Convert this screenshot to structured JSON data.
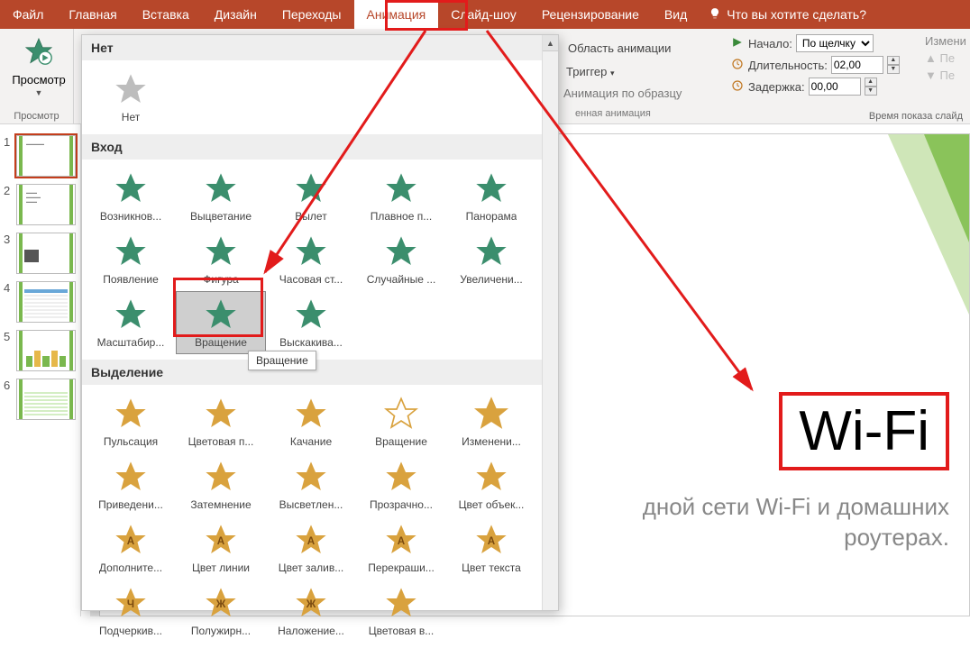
{
  "menu": {
    "file": "Файл",
    "home": "Главная",
    "insert": "Вставка",
    "design": "Дизайн",
    "transitions": "Переходы",
    "animation": "Анимация",
    "slideshow": "Слайд-шоу",
    "review": "Рецензирование",
    "view": "Вид",
    "tellme": "Что вы хотите сделать?"
  },
  "ribbon": {
    "preview_label": "Просмотр",
    "preview_group": "Просмотр",
    "anim_pane": "Область анимации",
    "trigger": "Триггер",
    "anim_painter": "Анимация по образцу",
    "adv_anim_group_frag": "енная анимация",
    "start_label": "Начало:",
    "start_value": "По щелчку",
    "duration_label": "Длительность:",
    "duration_value": "02,00",
    "delay_label": "Задержка:",
    "delay_value": "00,00",
    "change": "Измени",
    "earlier": "Пе",
    "later": "Пе",
    "timing_group": "Время показа слайд"
  },
  "gallery": {
    "none_hdr": "Нет",
    "none_item": "Нет",
    "entrance_hdr": "Вход",
    "emphasis_hdr": "Выделение",
    "tooltip": "Вращение",
    "entrance": [
      "Возникнов...",
      "Выцветание",
      "Вылет",
      "Плавное п...",
      "Панорама",
      "Появление",
      "Фигура",
      "Часовая ст...",
      "Случайные ...",
      "Увеличени...",
      "Масштабир...",
      "Вращение",
      "Выскакива..."
    ],
    "emphasis": [
      "Пульсация",
      "Цветовая п...",
      "Качание",
      "Вращение",
      "Изменени...",
      "Приведени...",
      "Затемнение",
      "Высветлен...",
      "Прозрачно...",
      "Цвет объек...",
      "Дополните...",
      "Цвет линии",
      "Цвет залив...",
      "Перекраши...",
      "Цвет текста",
      "Подчеркив...",
      "Полужирн...",
      "Наложение...",
      "Цветовая в..."
    ]
  },
  "slide": {
    "wifi": "Wi-Fi",
    "subtitle": "дной сети Wi-Fi и домашних роутерах."
  },
  "thumbs": [
    "1",
    "2",
    "3",
    "4",
    "5",
    "6"
  ]
}
